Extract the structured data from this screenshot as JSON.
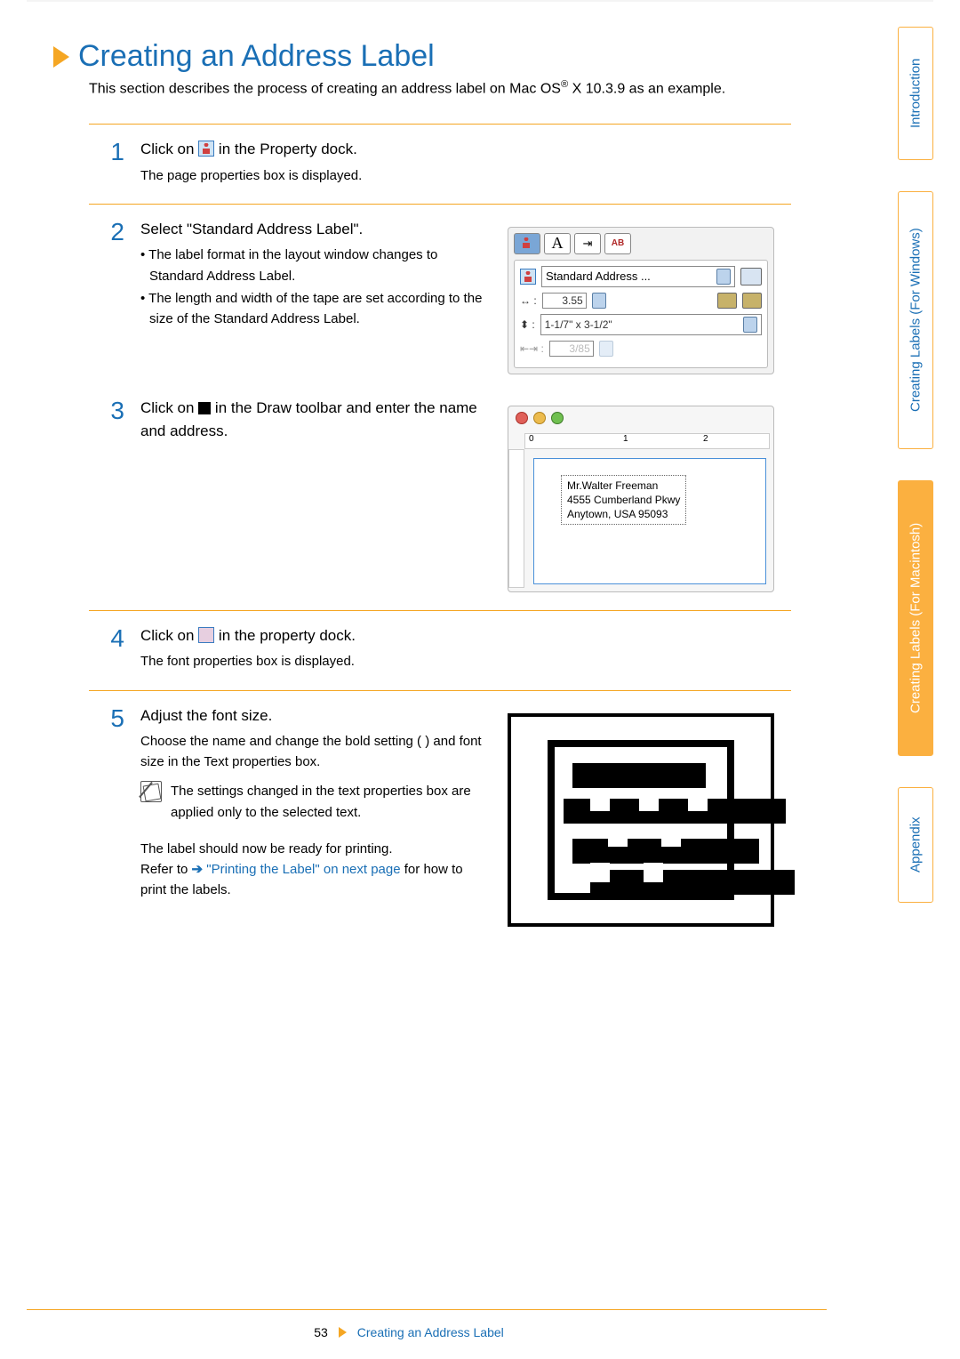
{
  "page": {
    "title": "Creating an Address Label",
    "intro_pre": "This section describes the process of creating an address label on  Mac OS",
    "intro_sup": "®",
    "intro_post": " X 10.3.9 as an example.",
    "page_number": "53",
    "footer_label": "Creating an Address Label"
  },
  "tabs": {
    "intro": "Introduction",
    "win": "Creating Labels (For Windows)",
    "mac": "Creating Labels (For Macintosh)",
    "appendix": "Appendix"
  },
  "steps": [
    {
      "num": "1",
      "head_pre": "Click on ",
      "head_post": " in the Property dock.",
      "sub": "The page properties box is displayed."
    },
    {
      "num": "2",
      "head": "Select \"Standard Address Label\".",
      "bullets": [
        "The label format in the layout window changes to Standard Address Label.",
        "The length and width of the tape are set according to the size of the Standard Address Label."
      ]
    },
    {
      "num": "3",
      "head_pre": "Click on ",
      "head_post": "in the Draw toolbar and enter the name and address."
    },
    {
      "num": "4",
      "head_pre": "Click on ",
      "head_post": " in the property dock.",
      "sub": "The font properties box is displayed."
    },
    {
      "num": "5",
      "head": "Adjust the font size.",
      "desc": "Choose the name and change the bold setting (   ) and font size in the Text properties box.",
      "note": "The settings changed in the text properties box are applied only to the selected text.",
      "ready1": "The label should now be ready for printing.",
      "ready2_pre": "Refer to ",
      "ready2_link": "\"Printing the Label\" on next page",
      "ready2_post": " for how to print the labels."
    }
  ],
  "fig2": {
    "select_label": "Standard Address ...",
    "width_value": "3.55",
    "dims": "1-1/7\" x 3-1/2\"",
    "margin_value": "3/85"
  },
  "fig3": {
    "ruler0": "0",
    "ruler1": "1",
    "ruler2": "2",
    "line1": "Mr.Walter Freeman",
    "line2": "4555 Cumberland Pkwy",
    "line3": "Anytown, USA 95093"
  }
}
